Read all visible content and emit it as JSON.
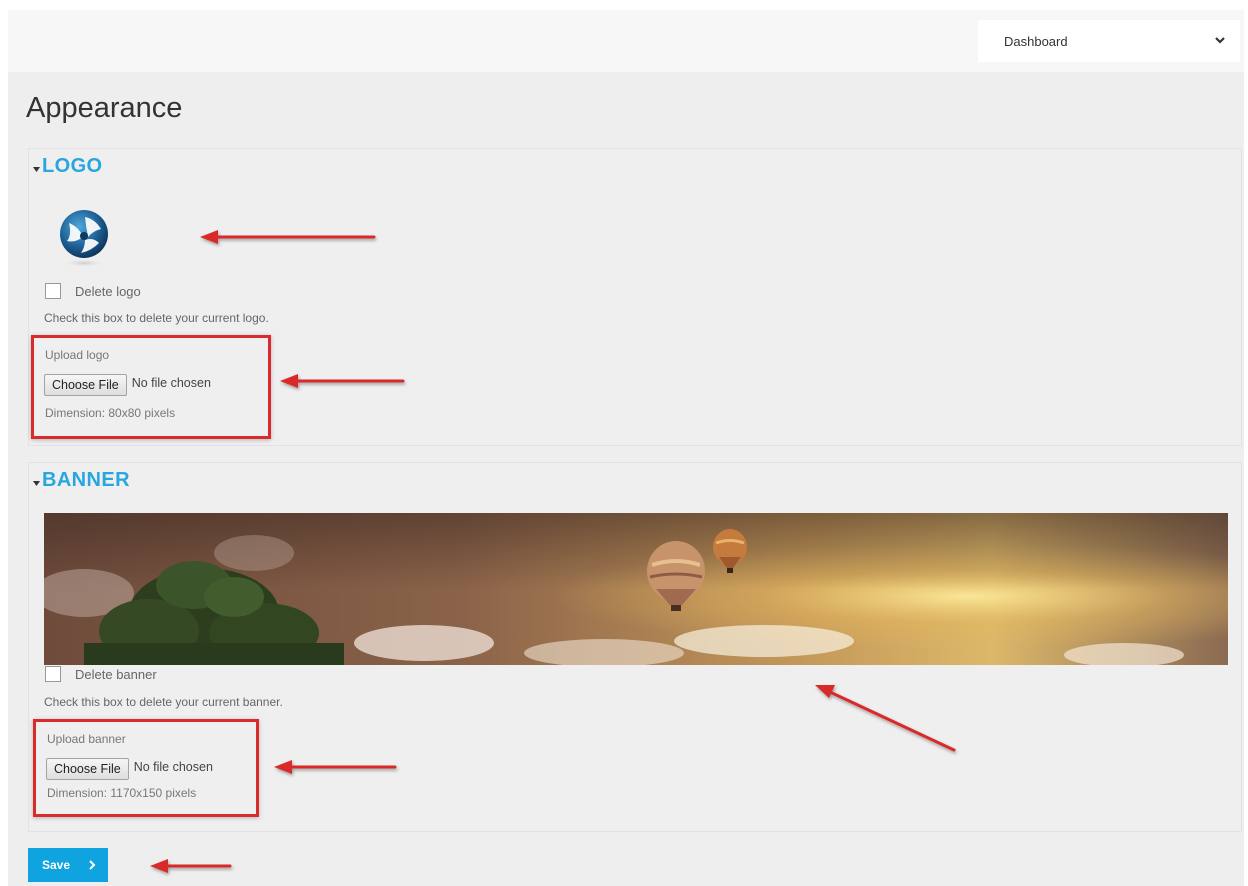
{
  "header": {
    "dashboard_select": {
      "value": "Dashboard"
    }
  },
  "page": {
    "title": "Appearance"
  },
  "logo_section": {
    "title": "LOGO",
    "delete_label": "Delete logo",
    "help_text": "Check this box to delete your current logo.",
    "upload_label": "Upload logo",
    "choose_button": "Choose File",
    "file_status": "No file chosen",
    "dimension": "Dimension: 80x80 pixels"
  },
  "banner_section": {
    "title": "BANNER",
    "delete_label": "Delete banner",
    "help_text": "Check this box to delete your current banner.",
    "upload_label": "Upload banner",
    "choose_button": "Choose File",
    "file_status": "No file chosen",
    "dimension": "Dimension: 1170x150 pixels"
  },
  "save_button": {
    "label": "Save"
  },
  "colors": {
    "section_title": "#29a6e0",
    "save_button": "#0fa3e0",
    "annotation_red": "#d92b2b"
  },
  "icons": [
    "chevron-down-icon",
    "caret-down-icon",
    "chevron-right-icon",
    "logo-image",
    "banner-image",
    "annotation-arrow"
  ]
}
